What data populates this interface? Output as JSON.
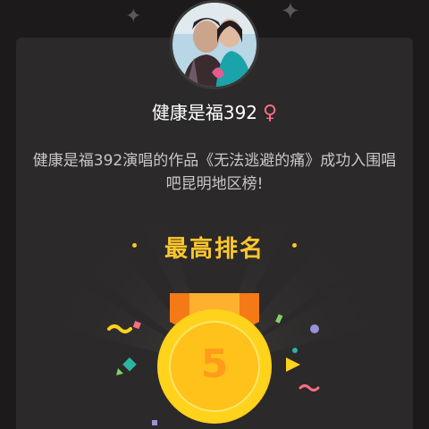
{
  "user": {
    "name": "健康是福392",
    "gender_symbol": "♀",
    "avatar_icon": "user-avatar-photo"
  },
  "message": {
    "text": "健康是福392演唱的作品《无法逃避的痛》成功入围唱吧昆明地区榜!"
  },
  "rank": {
    "title": "最高排名",
    "value": "5",
    "bullet": "·"
  },
  "colors": {
    "background": "#1c1a1b",
    "card": "#2b2929",
    "accent_gold": "#ffc72c",
    "medal_orange": "#ff9c1a",
    "gender_pink": "#ff6c85"
  },
  "decor": {
    "sparkle": "✦"
  }
}
